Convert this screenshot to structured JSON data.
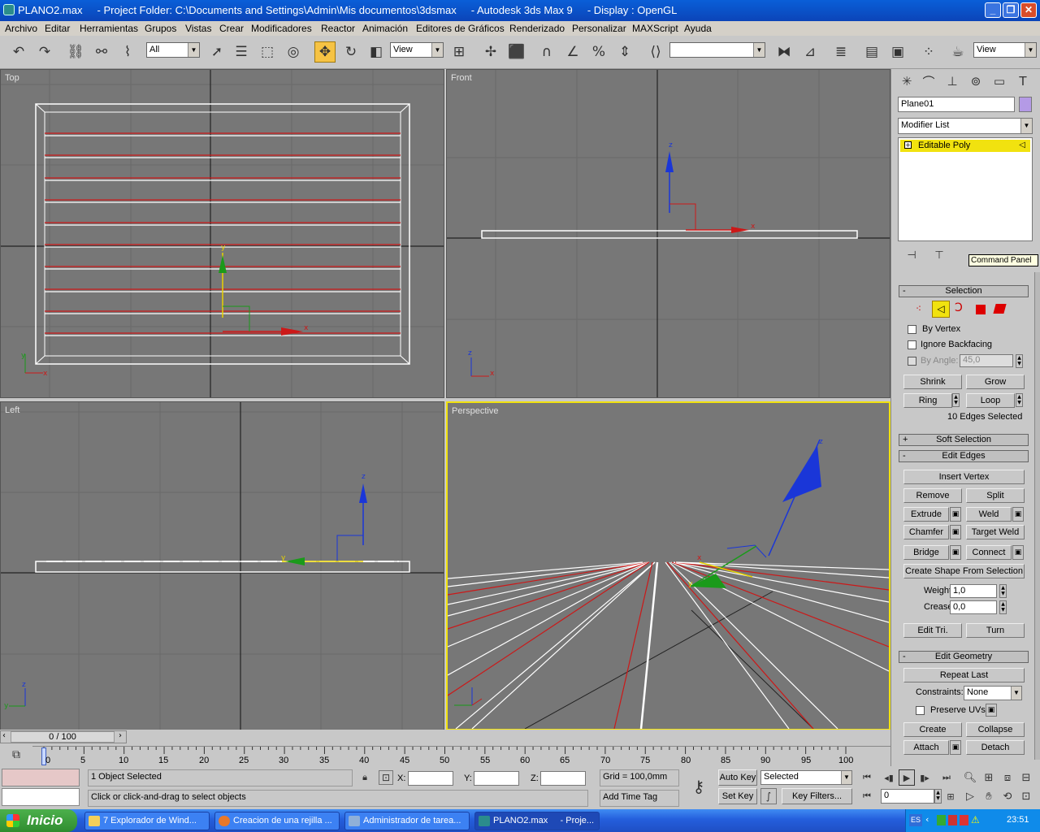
{
  "window": {
    "title": "PLANO2.max     - Project Folder: C:\\Documents and Settings\\Admin\\Mis documentos\\3dsmax     - Autodesk 3ds Max 9     - Display : OpenGL"
  },
  "menu": [
    "Archivo",
    "Editar",
    "Herramientas",
    "Grupos",
    "Vistas",
    "Crear",
    "Modificadores",
    "Reactor",
    "Animación",
    "Editores de Gráficos",
    "Renderizado",
    "Personalizar",
    "MAXScript",
    "Ayuda"
  ],
  "toolbar": {
    "selection_filter": "All",
    "ref_coord": "View",
    "named_sel": "",
    "view_combo": "View"
  },
  "viewports": {
    "top": "Top",
    "front": "Front",
    "left": "Left",
    "perspective": "Perspective"
  },
  "command_panel": {
    "object_name": "Plane01",
    "modifier_list": "Modifier List",
    "stack_item": "Editable Poly",
    "tooltip": "Command Panel",
    "selection": {
      "title": "Selection",
      "by_vertex": "By Vertex",
      "ignore_backfacing": "Ignore Backfacing",
      "by_angle": "By Angle:",
      "angle_value": "45,0",
      "shrink": "Shrink",
      "grow": "Grow",
      "ring": "Ring",
      "loop": "Loop",
      "status": "10 Edges Selected"
    },
    "soft_selection": "Soft Selection",
    "edit_edges": {
      "title": "Edit Edges",
      "insert_vertex": "Insert Vertex",
      "remove": "Remove",
      "split": "Split",
      "extrude": "Extrude",
      "weld": "Weld",
      "chamfer": "Chamfer",
      "target_weld": "Target Weld",
      "bridge": "Bridge",
      "connect": "Connect",
      "create_shape": "Create Shape From Selection",
      "weight_label": "Weight:",
      "weight": "1,0",
      "crease_label": "Crease:",
      "crease": "0,0",
      "edit_tri": "Edit Tri.",
      "turn": "Turn"
    },
    "edit_geometry": {
      "title": "Edit Geometry",
      "repeat_last": "Repeat Last",
      "constraints_label": "Constraints:",
      "constraints": "None",
      "preserve_uvs": "Preserve UVs",
      "create": "Create",
      "collapse": "Collapse",
      "attach": "Attach",
      "detach": "Detach"
    }
  },
  "timeline": {
    "frame_counter": "0 / 100",
    "ticks": [
      "0",
      "5",
      "10",
      "15",
      "20",
      "25",
      "30",
      "35",
      "40",
      "45",
      "50",
      "55",
      "60",
      "65",
      "70",
      "75",
      "80",
      "85",
      "90",
      "95",
      "100"
    ]
  },
  "status": {
    "selected": "1 Object Selected",
    "prompt": "Click or click-and-drag to select objects",
    "x_label": "X:",
    "y_label": "Y:",
    "z_label": "Z:",
    "grid": "Grid = 100,0mm",
    "add_time_tag": "Add Time Tag",
    "auto_key": "Auto Key",
    "set_key": "Set Key",
    "key_mode": "Selected",
    "key_filters": "Key Filters...",
    "frame": "0"
  },
  "taskbar": {
    "start": "Inicio",
    "items": [
      "7 Explorador de Wind...",
      "Creacion de una rejilla ...",
      "Administrador de tarea...",
      "PLANO2.max     - Proje..."
    ],
    "lang": "ES",
    "clock": "23:51"
  }
}
